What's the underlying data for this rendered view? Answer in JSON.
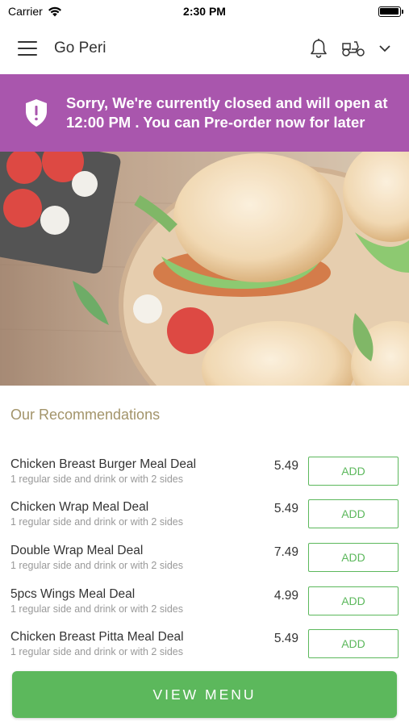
{
  "status_bar": {
    "carrier": "Carrier",
    "time": "2:30 PM"
  },
  "header": {
    "title": "Go Peri",
    "icons": [
      "menu-icon",
      "bell-icon",
      "scooter-icon",
      "chevron-down-icon"
    ]
  },
  "banner": {
    "text": "Sorry, We're currently closed and will open at 12:00 PM . You can Pre-order now for later",
    "color": "#a956ad",
    "icon": "shield-icon"
  },
  "recommendations": {
    "title": "Our Recommendations",
    "items": [
      {
        "name": "Chicken Breast Burger Meal Deal",
        "desc": "1 regular side and drink or with 2 sides",
        "price": "5.49",
        "button": "ADD"
      },
      {
        "name": "Chicken Wrap Meal Deal",
        "desc": "1 regular side and drink or with 2 sides",
        "price": "5.49",
        "button": "ADD"
      },
      {
        "name": "Double Wrap Meal Deal",
        "desc": "1 regular side and drink or with  2 sides",
        "price": "7.49",
        "button": "ADD"
      },
      {
        "name": "5pcs Wings Meal Deal",
        "desc": "1 regular side and drink or with 2 sides",
        "price": "4.99",
        "button": "ADD"
      },
      {
        "name": "Chicken Breast Pitta Meal Deal",
        "desc": "1 regular side and drink or with 2 sides",
        "price": "5.49",
        "button": "ADD"
      }
    ]
  },
  "view_menu": {
    "label": "VIEW MENU",
    "color": "#5cb85c"
  }
}
